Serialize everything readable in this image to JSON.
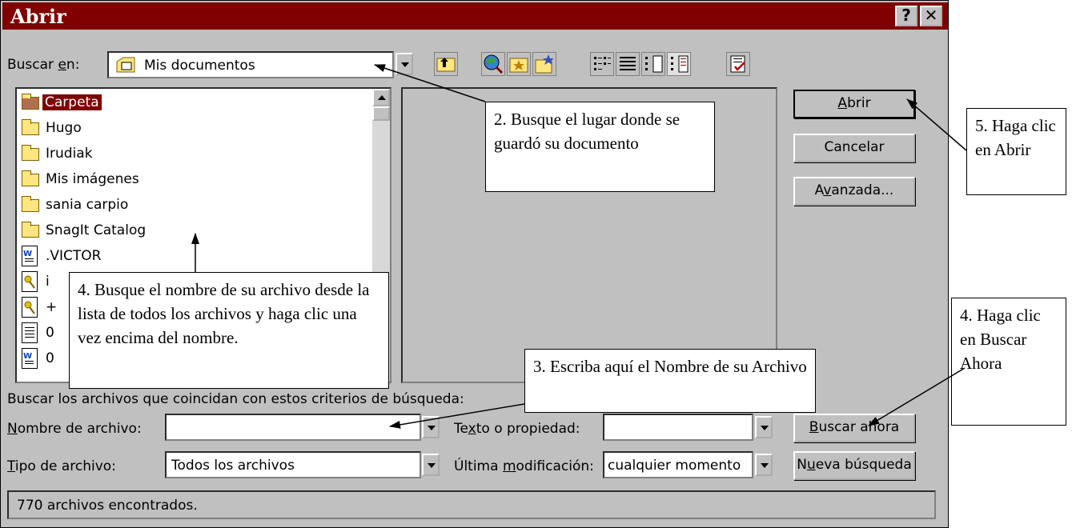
{
  "dialog": {
    "title": "Abrir",
    "help_label": "?",
    "close_label": "✕"
  },
  "lookin": {
    "label_pre": "Buscar ",
    "label_u": "e",
    "label_post": "n:",
    "value": "Mis documentos"
  },
  "files": [
    {
      "name": "Carpeta",
      "type": "folder-dark",
      "selected": true
    },
    {
      "name": "Hugo",
      "type": "folder"
    },
    {
      "name": "Irudiak",
      "type": "folder"
    },
    {
      "name": "Mis imágenes",
      "type": "folder"
    },
    {
      "name": "sania carpio",
      "type": "folder"
    },
    {
      "name": "SnagIt Catalog",
      "type": "folder"
    },
    {
      "name": ".VICTOR",
      "type": "word"
    },
    {
      "name": "i",
      "type": "key"
    },
    {
      "name": "+",
      "type": "key"
    },
    {
      "name": "0",
      "type": "text"
    },
    {
      "name": "0",
      "type": "word"
    }
  ],
  "buttons": {
    "open_u": "A",
    "open_rest": "brir",
    "cancel": "Cancelar",
    "advanced_pre": "A",
    "advanced_u": "v",
    "advanced_post": "anzada...",
    "find_now_u": "B",
    "find_now_rest": "uscar ahora",
    "new_search_pre": "N",
    "new_search_u": "u",
    "new_search_post": "eva búsqueda"
  },
  "criteria": {
    "heading": "Buscar los archivos que coincidan con estos criterios de búsqueda:",
    "filename_u": "N",
    "filename_rest": "ombre de archivo:",
    "filename_value": "",
    "filetype_u": "T",
    "filetype_rest": "ipo de archivo:",
    "filetype_value": "Todos los archivos",
    "text_pre": "Te",
    "text_u": "x",
    "text_post": "to o propiedad:",
    "text_value": "",
    "modified_pre": "Última ",
    "modified_u": "m",
    "modified_post": "odificación:",
    "modified_value": "cualquier momento"
  },
  "status": "770 archivos encontrados.",
  "callouts": {
    "c2": "2.  Busque el lugar donde se guardó su documento",
    "c3": "3.  Escriba aquí el Nombre de su Archivo",
    "c4": "4.  Busque el nombre de su archivo desde la lista de todos los archivos y haga clic una vez encima del nombre.",
    "c4b": "4. Haga clic en Buscar Ahora",
    "c5": "5.  Haga clic en Abrir"
  },
  "colors": {
    "titlebar": "#800000",
    "selection": "#800000",
    "dialog_bg": "#c0c0c0"
  }
}
